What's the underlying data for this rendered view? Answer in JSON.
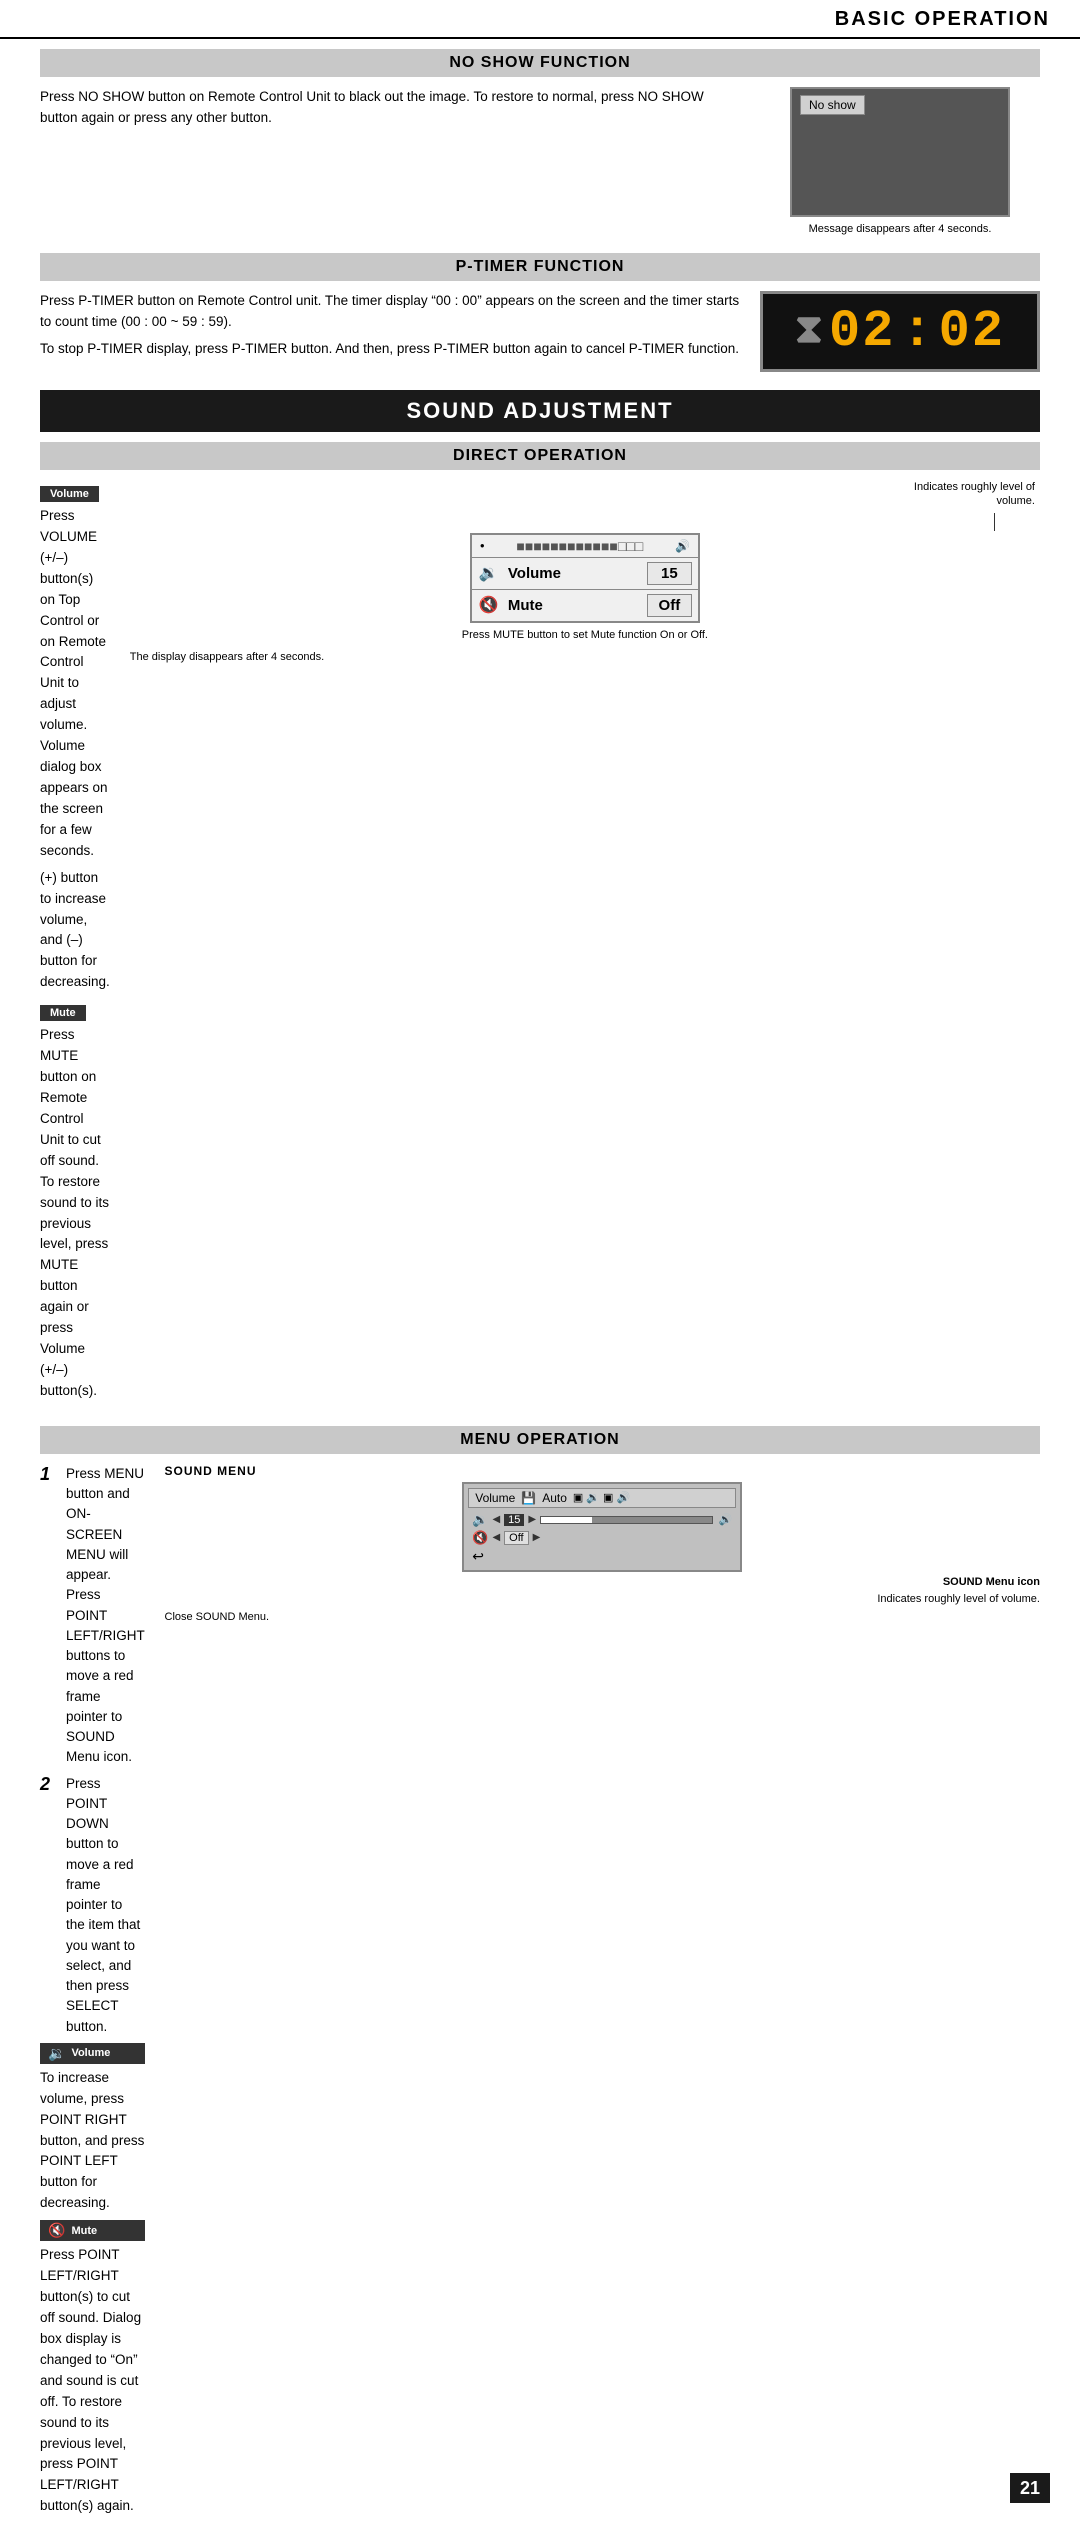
{
  "header": {
    "title": "BASIC OPERATION"
  },
  "no_show_section": {
    "title": "NO SHOW FUNCTION",
    "body": "Press NO SHOW button on Remote Control Unit to black out the image.  To restore to normal, press NO SHOW button again or press any other button.",
    "screen_label": "No show",
    "caption": "Message disappears after 4 seconds."
  },
  "ptimer_section": {
    "title": "P-TIMER FUNCTION",
    "body1": "Press P-TIMER button on Remote Control unit.  The timer display “00 : 00” appears on the screen and the timer starts to count time (00 : 00 ~ 59 : 59).",
    "body2": "To stop P-TIMER display, press P-TIMER button.  And then, press P-TIMER button again to cancel P-TIMER function.",
    "display_time": "02:02",
    "display_time_left": "02",
    "display_time_right": "02"
  },
  "sound_adjustment": {
    "title": "SOUND ADJUSTMENT",
    "direct_operation": {
      "title": "DIRECT OPERATION",
      "volume_label": "Volume",
      "volume_body1": "Press VOLUME (+/–) button(s) on Top Control or on Remote Control Unit to adjust volume.  Volume dialog box appears on the screen for a few seconds.",
      "volume_body2": "(+) button to increase volume, and (–) button for decreasing.",
      "mute_label": "Mute",
      "mute_body": "Press MUTE button on Remote Control Unit to cut off sound.  To restore sound to its previous level, press MUTE button again or press Volume (+/–) button(s).",
      "display_volume_label": "Volume",
      "display_volume_value": "15",
      "display_mute_label": "Mute",
      "display_mute_value": "Off",
      "indicator_text": "Indicates roughly level of\nvolume.",
      "mute_caption": "Press MUTE button to set\nMute function On or Off.",
      "disappears_caption": "The display disappears after 4 seconds."
    },
    "menu_operation": {
      "title": "MENU OPERATION",
      "step1": "Press MENU button and ON-SCREEN MENU will appear.  Press POINT LEFT/RIGHT buttons to move a red frame pointer to SOUND Menu icon.",
      "step2": "Press POINT DOWN button to move a red frame pointer to the item that you want to select, and then press SELECT button.",
      "volume_label": "Volume",
      "volume_body": "To increase volume, press POINT RIGHT button, and press POINT LEFT button for decreasing.",
      "mute_label": "Mute",
      "mute_body": "Press POINT LEFT/RIGHT button(s) to cut off sound.  Dialog box display is changed to “On” and sound is cut off.  To restore sound to its previous level, press POINT LEFT/RIGHT button(s) again.",
      "sound_menu_title": "SOUND MENU",
      "sound_menu_icon_label": "SOUND Menu icon",
      "indicates_text": "Indicates roughly\nlevel of volume.",
      "close_sound_menu": "Close SOUND Menu.",
      "top_bar_label": "Volume",
      "top_bar_option": "Auto"
    }
  },
  "page_number": "21"
}
